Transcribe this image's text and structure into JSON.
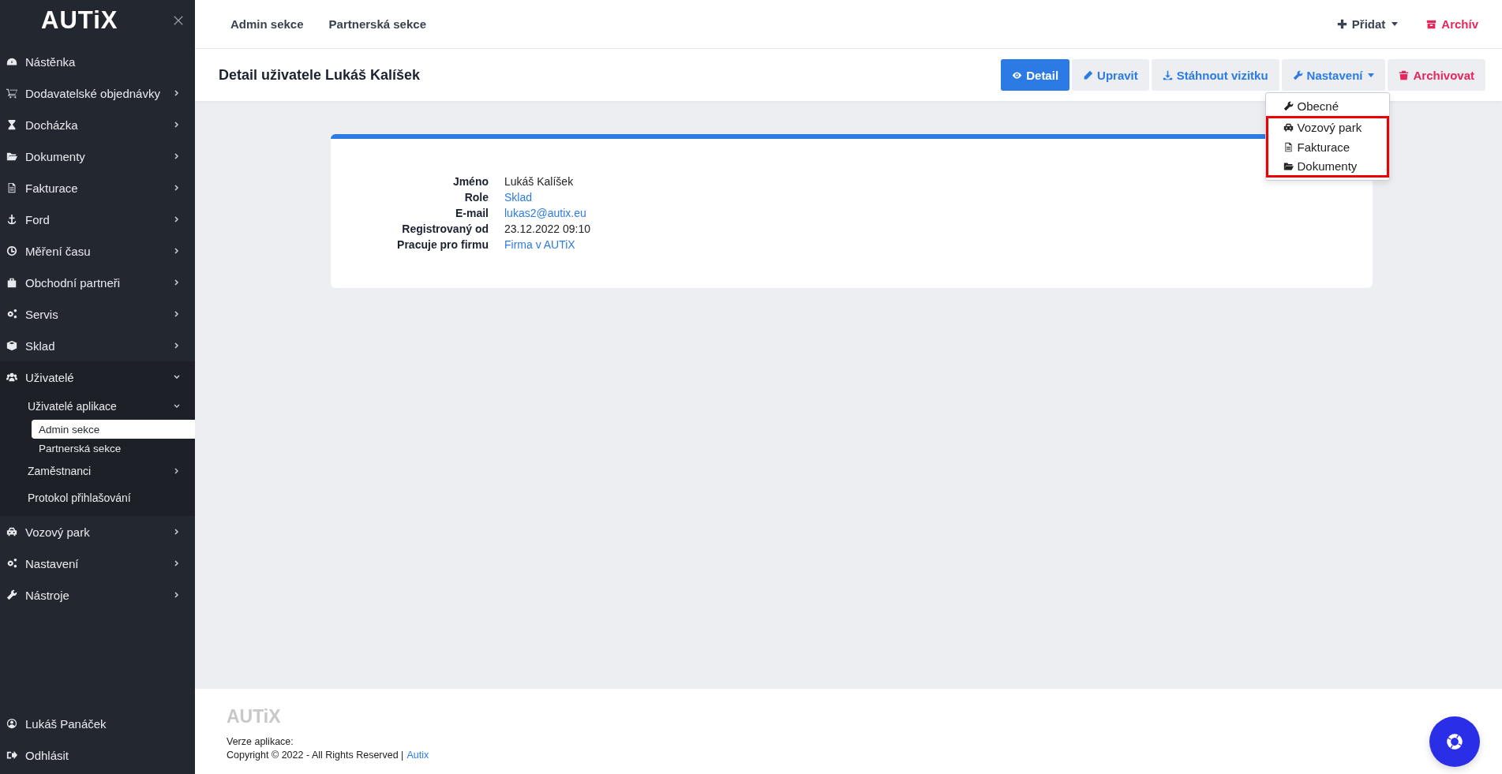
{
  "sidebar": {
    "logo": "AUTiX",
    "items": [
      {
        "label": "Nástěnka"
      },
      {
        "label": "Dodavatelské objednávky",
        "expanded": false
      },
      {
        "label": "Docházka",
        "expanded": false
      },
      {
        "label": "Dokumenty",
        "expanded": false
      },
      {
        "label": "Fakturace",
        "expanded": false
      },
      {
        "label": "Ford",
        "expanded": false
      },
      {
        "label": "Měření času",
        "expanded": false
      },
      {
        "label": "Obchodní partneři",
        "expanded": false
      },
      {
        "label": "Servis",
        "expanded": false
      },
      {
        "label": "Sklad",
        "expanded": false
      },
      {
        "label": "Uživatelé",
        "expanded": true,
        "children": [
          {
            "label": "Uživatelé aplikace",
            "expanded": true,
            "children": [
              {
                "label": "Admin sekce",
                "selected": true
              },
              {
                "label": "Partnerská sekce",
                "selected": false
              }
            ]
          },
          {
            "label": "Zaměstnanci",
            "expanded": false
          },
          {
            "label": "Protokol přihlašování"
          }
        ]
      },
      {
        "label": "Vozový park",
        "expanded": false
      },
      {
        "label": "Nastavení",
        "expanded": false
      },
      {
        "label": "Nástroje",
        "expanded": false
      }
    ],
    "bottom": [
      {
        "label": "Lukáš Panáček"
      },
      {
        "label": "Odhlásit"
      }
    ]
  },
  "topbar": {
    "links": [
      "Admin sekce",
      "Partnerská sekce"
    ],
    "actions": [
      {
        "label": "Přidat",
        "kind": "dropdown"
      },
      {
        "label": "Archív",
        "kind": "danger"
      }
    ]
  },
  "header": {
    "title": "Detail uživatele Lukáš Kalíšek",
    "buttons": [
      {
        "label": "Detail",
        "kind": "primary"
      },
      {
        "label": "Upravit",
        "kind": "default"
      },
      {
        "label": "Stáhnout vizitku",
        "kind": "default"
      },
      {
        "label": "Nastavení",
        "kind": "dropdown",
        "expanded": true
      },
      {
        "label": "Archivovat",
        "kind": "danger"
      }
    ],
    "menu": [
      {
        "label": "Obecné",
        "highlighted": false
      },
      {
        "label": "Vozový park",
        "highlighted": true
      },
      {
        "label": "Fakturace",
        "highlighted": true
      },
      {
        "label": "Dokumenty",
        "highlighted": true
      }
    ]
  },
  "details": [
    {
      "label": "Jméno",
      "value": "Lukáš Kalíšek",
      "kind": "text"
    },
    {
      "label": "Role",
      "value": "Sklad",
      "kind": "link"
    },
    {
      "label": "E-mail",
      "value": "lukas2@autix.eu",
      "kind": "link"
    },
    {
      "label": "Registrovaný od",
      "value": "23.12.2022 09:10",
      "kind": "text"
    },
    {
      "label": "Pracuje pro firmu",
      "value": "Firma v AUTiX",
      "kind": "link"
    }
  ],
  "footer": {
    "logo": "AUTiX",
    "version": "Verze aplikace:",
    "copyright": "Copyright © 2022 - All Rights Reserved |",
    "link": "Autix"
  }
}
